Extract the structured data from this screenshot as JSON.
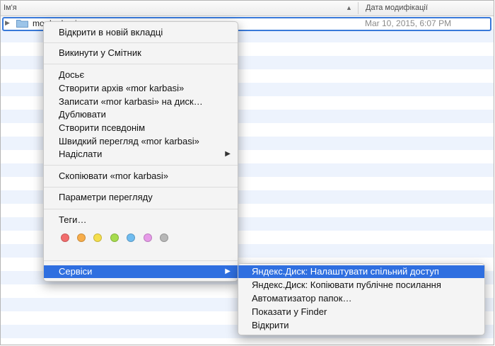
{
  "columns": {
    "name": "Ім'я",
    "sort_indicator": "▲",
    "date": "Дата модифікації"
  },
  "row": {
    "name": "mor karbasi",
    "date": "Mar 10, 2015, 6:07 PM"
  },
  "menu": {
    "open_new_tab": "Відкрити в новій вкладці",
    "move_to_trash": "Викинути у Смітник",
    "get_info": "Досьє",
    "compress": "Створити архів «mor karbasi»",
    "burn": "Записати «mor karbasi» на диск…",
    "duplicate": "Дублювати",
    "make_alias": "Створити псевдонім",
    "quick_look": "Швидкий перегляд «mor karbasi»",
    "share": "Надіслати",
    "copy": "Скопіювати «mor karbasi»",
    "view_options": "Параметри перегляду",
    "tags": "Теги…",
    "services": "Сервіси",
    "submenu_arrow": "▶"
  },
  "tag_colors": [
    "#f26d6d",
    "#f7ad4a",
    "#f4de4c",
    "#a6dc4e",
    "#6fbcf0",
    "#e69ae8",
    "#b7b7b7"
  ],
  "services_submenu": [
    "Яндекс.Диск: Налаштувати спільний доступ",
    "Яндекс.Диск: Копіювати публічне посилання",
    "Автоматизатор папок…",
    "Показати у Finder",
    "Відкрити"
  ],
  "colors": {
    "selection": "#2f6fe0",
    "row_outline": "#3879d9",
    "stripe": "#edf3fd"
  }
}
